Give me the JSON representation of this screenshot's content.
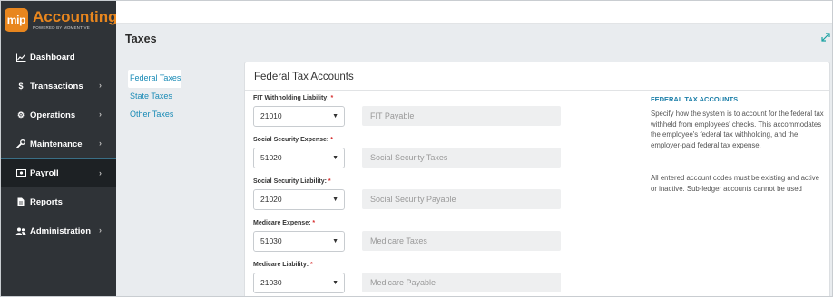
{
  "brand": {
    "badge": "mip",
    "title": "Accounting",
    "subtitle": "POWERED BY MOMENTIVE",
    "accent": "#e8861e"
  },
  "sidebar": {
    "items": [
      {
        "label": "Dashboard",
        "icon": "chart-line-icon",
        "has_chevron": false
      },
      {
        "label": "Transactions",
        "icon": "dollar-icon",
        "has_chevron": true
      },
      {
        "label": "Operations",
        "icon": "gears-icon",
        "has_chevron": true
      },
      {
        "label": "Maintenance",
        "icon": "wrench-icon",
        "has_chevron": true
      },
      {
        "label": "Payroll",
        "icon": "money-icon",
        "has_chevron": true,
        "active": true
      },
      {
        "label": "Reports",
        "icon": "file-icon",
        "has_chevron": false
      },
      {
        "label": "Administration",
        "icon": "users-icon",
        "has_chevron": true
      }
    ]
  },
  "page": {
    "title": "Taxes"
  },
  "subnav": {
    "items": [
      {
        "label": "Federal Taxes",
        "active": true
      },
      {
        "label": "State Taxes"
      },
      {
        "label": "Other Taxes"
      }
    ]
  },
  "panel": {
    "title": "Federal Tax Accounts",
    "fields": [
      {
        "label": "FIT Withholding Liability:",
        "required": "*",
        "value": "21010",
        "description": "FIT Payable"
      },
      {
        "label": "Social Security Expense:",
        "required": "*",
        "value": "51020",
        "description": "Social Security Taxes"
      },
      {
        "label": "Social Security Liability:",
        "required": "*",
        "value": "21020",
        "description": "Social Security Payable"
      },
      {
        "label": "Medicare Expense:",
        "required": "*",
        "value": "51030",
        "description": "Medicare Taxes"
      },
      {
        "label": "Medicare Liability:",
        "required": "*",
        "value": "21030",
        "description": "Medicare Payable"
      }
    ],
    "help": {
      "title": "FEDERAL TAX ACCOUNTS",
      "paragraph1": "Specify how the system is to account for the federal tax withheld from employees' checks. This accommodates the employee's federal tax withholding, and the employer-paid federal tax expense.",
      "paragraph2": "All entered account codes must be existing and active or inactive. Sub-ledger accounts cannot be used"
    }
  },
  "colors": {
    "sidebar_bg": "#2f3337",
    "link": "#1a8bb6",
    "required": "#d62d2d"
  }
}
